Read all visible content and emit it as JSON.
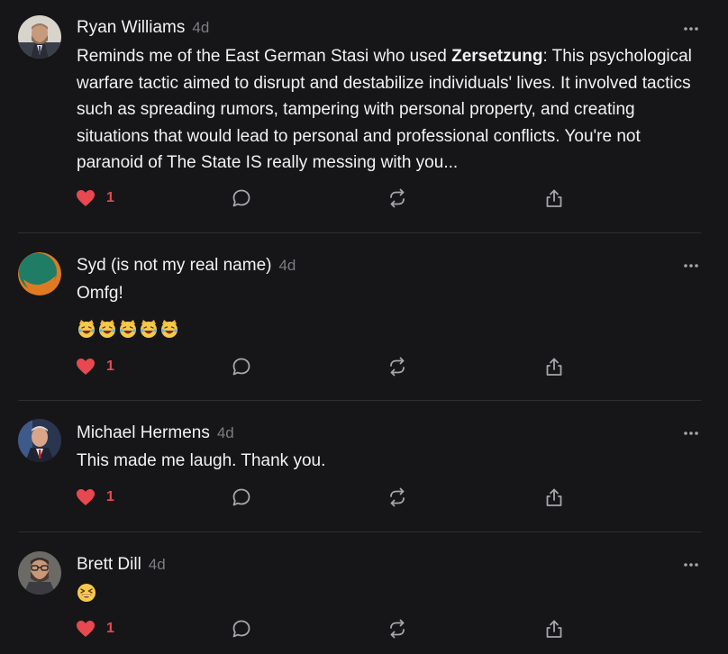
{
  "comments": [
    {
      "author": "Ryan Williams",
      "time": "4d",
      "text_before": "Reminds me of the East German Stasi who used ",
      "text_bold": "Zersetzung",
      "text_after": ": This psychological warfare tactic aimed to disrupt and destabilize individuals' lives. It involved tactics such as spreading rumors, tampering with personal property, and creating situations that would lead to personal and professional conflicts. You're not paranoid of The State IS really messing with you...",
      "likes": "1",
      "avatar": "avatar-bearded-man-suit"
    },
    {
      "author": "Syd (is not my real name)",
      "time": "4d",
      "text": "Omfg!",
      "emoji": [
        "laughing-cat-emoji",
        "laughing-cat-emoji",
        "laughing-cat-emoji",
        "laughing-cat-emoji",
        "laughing-cat-emoji"
      ],
      "likes": "1",
      "avatar": "avatar-green-orange-circle"
    },
    {
      "author": "Michael Hermens",
      "time": "4d",
      "text": "This made me laugh. Thank you.",
      "likes": "1",
      "avatar": "avatar-man-red-tie"
    },
    {
      "author": "Brett Dill",
      "time": "4d",
      "emoji": [
        "grinning-squinting-face-emoji"
      ],
      "likes": "1",
      "avatar": "avatar-man-glasses-beard"
    }
  ],
  "icons": {
    "like": "heart-icon",
    "reply": "speech-bubble-icon",
    "restack": "restack-arrows-icon",
    "share": "share-upload-icon",
    "more": "more-dots-icon"
  },
  "colors": {
    "background": "#161618",
    "text": "#f2f2f2",
    "muted": "#7d7d82",
    "like": "#e8484f",
    "divider": "#2e2e32"
  }
}
